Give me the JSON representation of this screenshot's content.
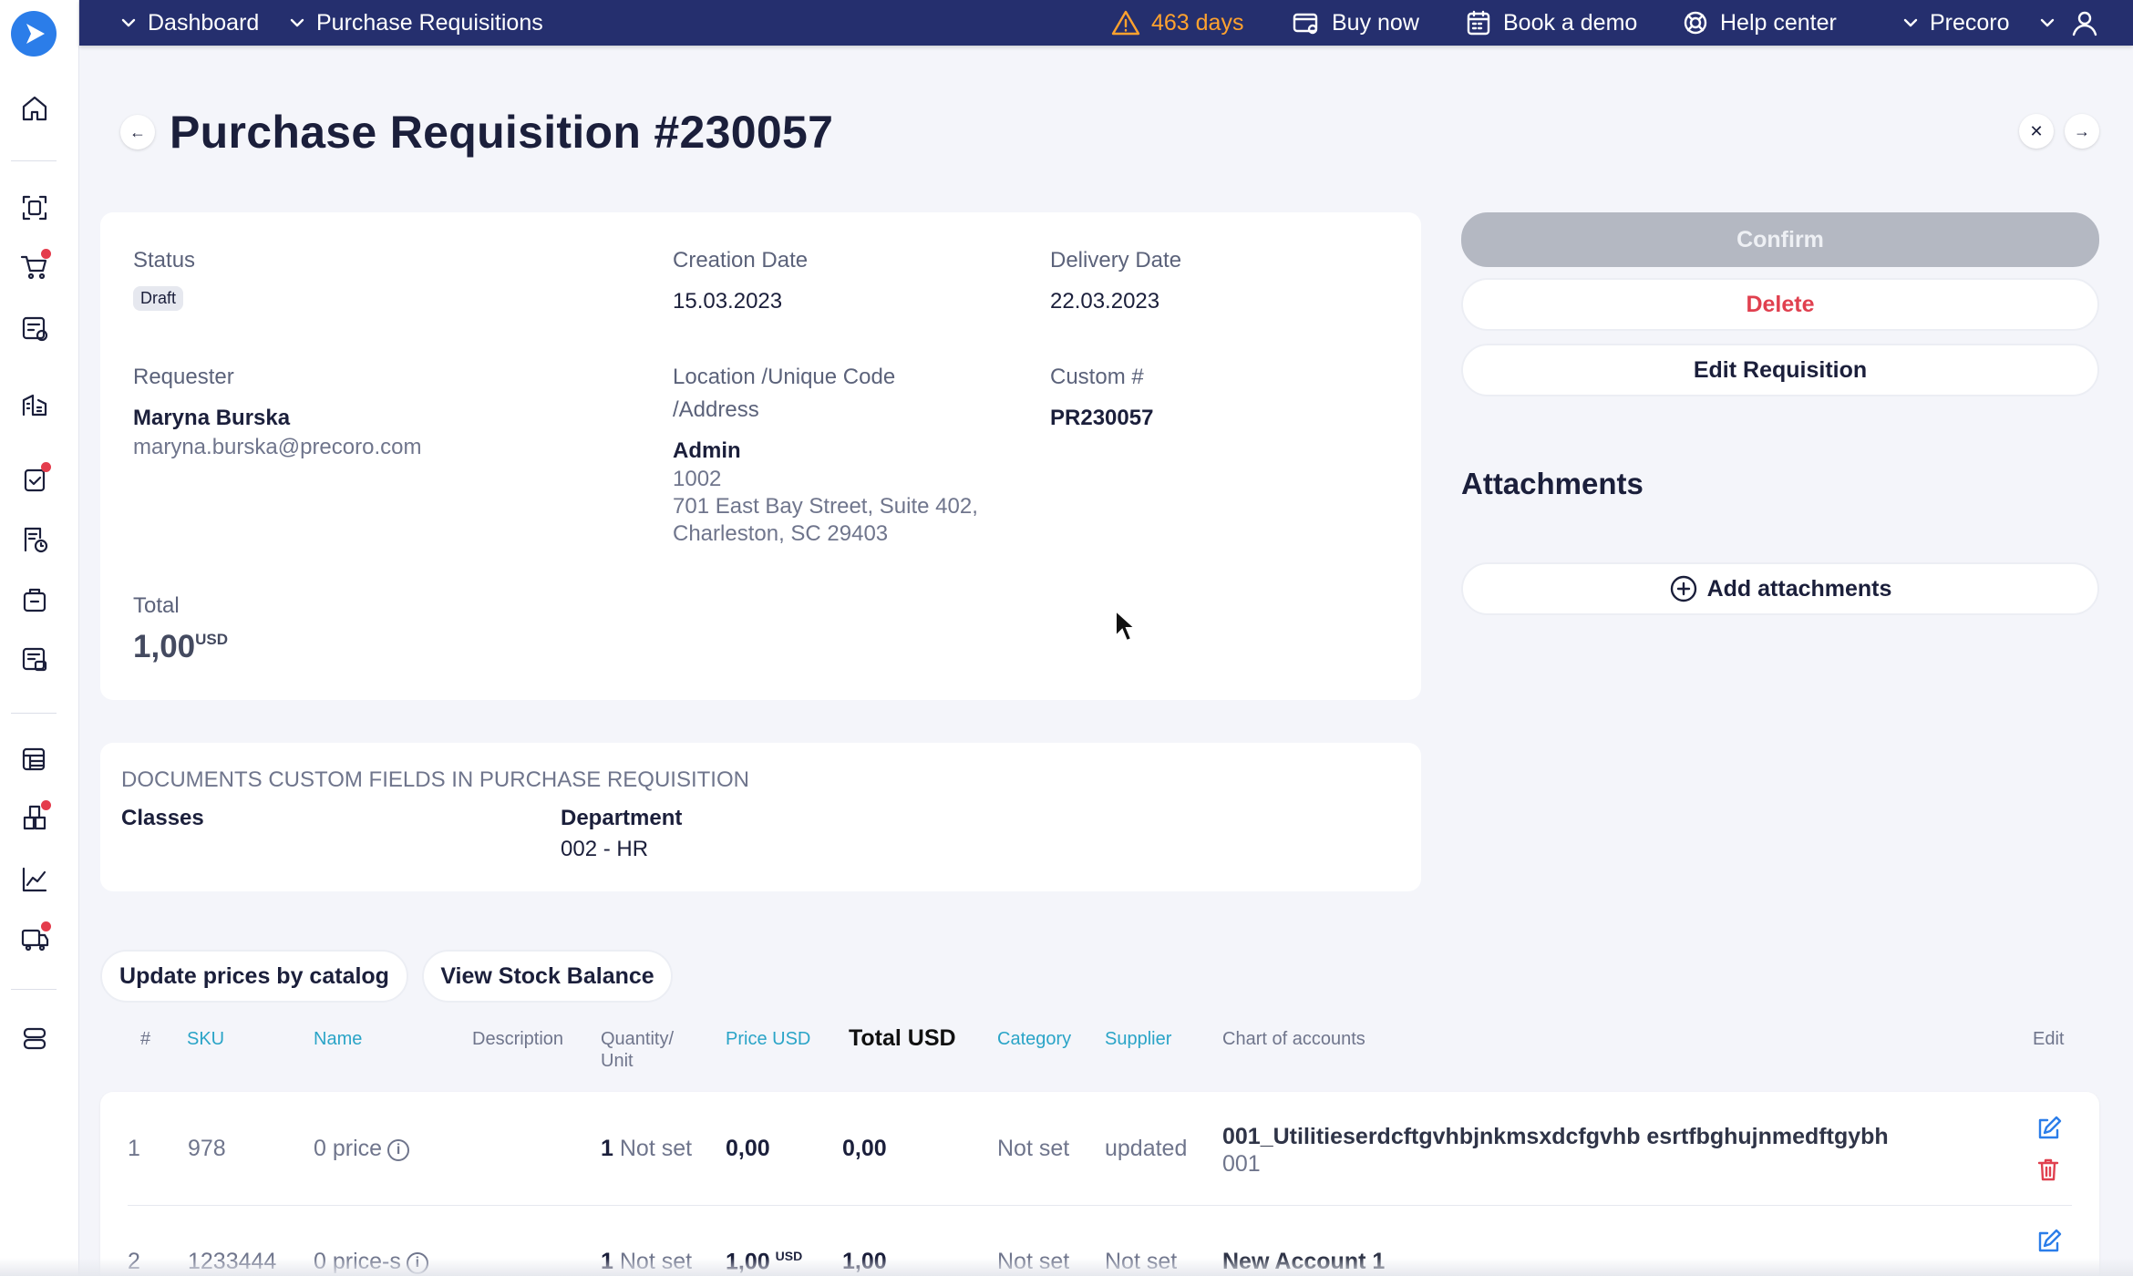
{
  "topbar": {
    "nav": [
      "Dashboard",
      "Purchase Requisitions"
    ],
    "trial": "463 days",
    "buy": "Buy now",
    "demo": "Book a demo",
    "help": "Help center",
    "company": "Precoro"
  },
  "page": {
    "title": "Purchase Requisition #230057"
  },
  "details": {
    "status_label": "Status",
    "status_value": "Draft",
    "creation_label": "Creation Date",
    "creation_value": "15.03.2023",
    "delivery_label": "Delivery Date",
    "delivery_value": "22.03.2023",
    "requester_label": "Requester",
    "requester_name": "Maryna Burska",
    "requester_email": "maryna.burska@precoro.com",
    "location_label_1": "Location /Unique Code",
    "location_label_2": "/Address",
    "location_name": "Admin",
    "location_code": "1002",
    "location_addr_1": "701 East Bay Street, Suite 402,",
    "location_addr_2": "Charleston, SC 29403",
    "custom_label": "Custom #",
    "custom_value": "PR230057",
    "total_label": "Total",
    "total_value": "1,00",
    "total_currency": "USD"
  },
  "custom_fields": {
    "heading": "DOCUMENTS CUSTOM FIELDS IN PURCHASE REQUISITION",
    "classes_label": "Classes",
    "department_label": "Department",
    "department_value": "002 - HR"
  },
  "actions": {
    "confirm": "Confirm",
    "delete": "Delete",
    "edit": "Edit Requisition"
  },
  "attachments": {
    "title": "Attachments",
    "add": "Add attachments"
  },
  "toolbar": {
    "update_prices": "Update prices by catalog",
    "stock": "View Stock Balance"
  },
  "table": {
    "headers": {
      "num": "#",
      "sku": "SKU",
      "name": "Name",
      "description": "Description",
      "qty_1": "Quantity/",
      "qty_2": "Unit",
      "price": "Price USD",
      "total": "Total USD",
      "category": "Category",
      "supplier": "Supplier",
      "account": "Chart of accounts",
      "edit": "Edit"
    },
    "rows": [
      {
        "num": "1",
        "sku": "978",
        "name": "0 price",
        "qty": "1",
        "unit": "Not set",
        "price": "0,00",
        "price_currency": "",
        "total": "0,00",
        "category": "Not set",
        "supplier": "updated",
        "account_name": "001_Utilitieserdcftgvhbjnkmsxdcfgvhb esrtfbghujnmedftgybh",
        "account_code": "001"
      },
      {
        "num": "2",
        "sku": "1233444",
        "name": "0 price-s",
        "qty": "1",
        "unit": "Not set",
        "price": "1,00",
        "price_currency": "USD",
        "total": "1,00",
        "category": "Not set",
        "supplier": "Not set",
        "account_name": "New Account 1",
        "account_code": ""
      }
    ]
  },
  "colors": {
    "topbar": "#252f6e",
    "accent": "#2b7de9",
    "link": "#2aa4c7",
    "danger": "#e0404f",
    "warning": "#ffa22e"
  }
}
